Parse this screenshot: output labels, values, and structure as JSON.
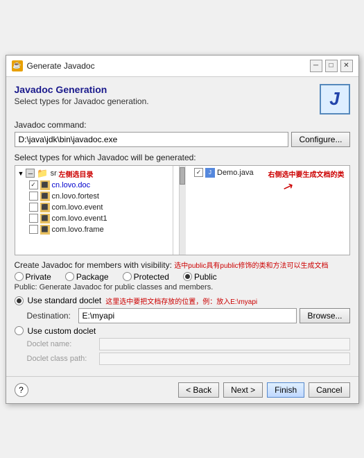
{
  "window": {
    "title": "Generate Javadoc",
    "icon": "☕"
  },
  "page": {
    "title": "Javadoc Generation",
    "subtitle": "Select types for Javadoc generation."
  },
  "command": {
    "label": "Javadoc command:",
    "value": "D:\\java\\jdk\\bin\\javadoc.exe",
    "configure_btn": "Configure..."
  },
  "types": {
    "label": "Select types for which Javadoc will be generated:",
    "left_annotation": "左侧选目录",
    "right_annotation": "右侧选中要生成文档的类",
    "left_items": [
      {
        "type": "expand",
        "icon": "▶",
        "check": "partial",
        "name": "src"
      },
      {
        "type": "pkg",
        "check": "checked",
        "name": "cn.lovo.doc"
      },
      {
        "type": "pkg",
        "check": "unchecked",
        "name": "cn.lovo.fortest"
      },
      {
        "type": "pkg",
        "check": "unchecked",
        "name": "com.lovo.event"
      },
      {
        "type": "pkg",
        "check": "unchecked",
        "name": "com.lovo.event1"
      },
      {
        "type": "pkg",
        "check": "unchecked",
        "name": "com.lovo.frame"
      }
    ],
    "right_items": [
      {
        "type": "file",
        "check": "checked",
        "name": "Demo.java"
      }
    ]
  },
  "visibility": {
    "label": "Create Javadoc for members with visibility:",
    "annotation": "选中public具有public修饰的类和方法可以生成文档",
    "options": [
      "Private",
      "Package",
      "Protected",
      "Public"
    ],
    "selected": "Public",
    "public_desc": "Public: Generate Javadoc for public classes and members."
  },
  "doclet": {
    "standard_label": "Use standard doclet",
    "standard_annotation": "这里选中要把文档存放的位置，例：放入E:\\myapi",
    "destination_label": "Destination:",
    "destination_value": "E:\\myapi",
    "browse_btn": "Browse...",
    "custom_label": "Use custom doclet",
    "name_label": "Doclet name:",
    "classpath_label": "Doclet class path:"
  },
  "buttons": {
    "help": "?",
    "back": "< Back",
    "next": "Next >",
    "finish": "Finish",
    "cancel": "Cancel"
  }
}
